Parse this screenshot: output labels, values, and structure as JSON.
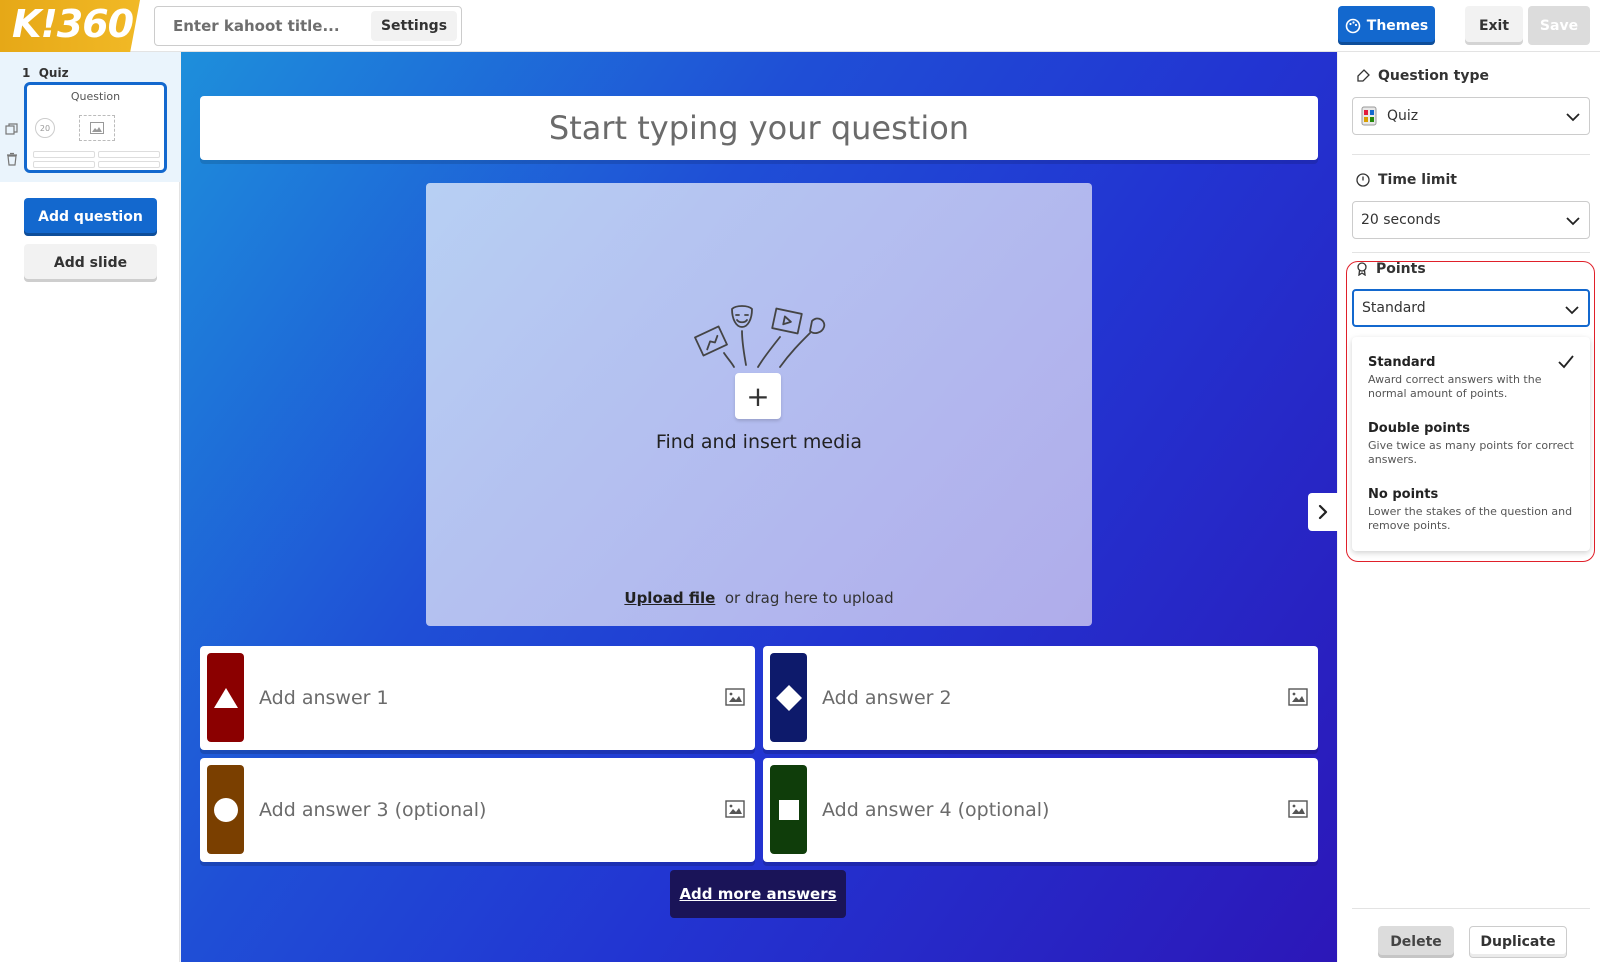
{
  "app": {
    "logo_text": "K!360"
  },
  "header": {
    "title_placeholder": "Enter kahoot title...",
    "settings_label": "Settings",
    "themes_label": "Themes",
    "exit_label": "Exit",
    "save_label": "Save"
  },
  "sidebar": {
    "slides": [
      {
        "number": "1",
        "type": "Quiz",
        "thumb_title": "Question",
        "thumb_timer": "20"
      }
    ],
    "add_question_label": "Add question",
    "add_slide_label": "Add slide"
  },
  "editor": {
    "question_placeholder": "Start typing your question",
    "media_label": "Find and insert media",
    "upload_link": "Upload file",
    "upload_suffix": "or drag here to upload",
    "answers": [
      {
        "placeholder": "Add answer 1",
        "color": "#8b0000",
        "shape": "triangle"
      },
      {
        "placeholder": "Add answer 2",
        "color": "#0d1a6b",
        "shape": "diamond"
      },
      {
        "placeholder": "Add answer 3 (optional)",
        "color": "#7a3f00",
        "shape": "circle"
      },
      {
        "placeholder": "Add answer 4 (optional)",
        "color": "#0f3d0a",
        "shape": "square"
      }
    ],
    "add_more_label": "Add more answers"
  },
  "right_panel": {
    "question_type_label": "Question type",
    "question_type_value": "Quiz",
    "time_limit_label": "Time limit",
    "time_limit_value": "20 seconds",
    "points_label": "Points",
    "points_value": "Standard",
    "points_options": [
      {
        "title": "Standard",
        "desc": "Award correct answers with the normal amount of points.",
        "selected": true
      },
      {
        "title": "Double points",
        "desc": "Give twice as many points for correct answers.",
        "selected": false
      },
      {
        "title": "No points",
        "desc": "Lower the stakes of the question and remove points.",
        "selected": false
      }
    ],
    "delete_label": "Delete",
    "duplicate_label": "Duplicate"
  },
  "colors": {
    "primary_blue": "#1368ce",
    "logo_gold": "#e6a817",
    "highlight_red": "#e0202a",
    "add_more_bg": "#1a1458"
  }
}
